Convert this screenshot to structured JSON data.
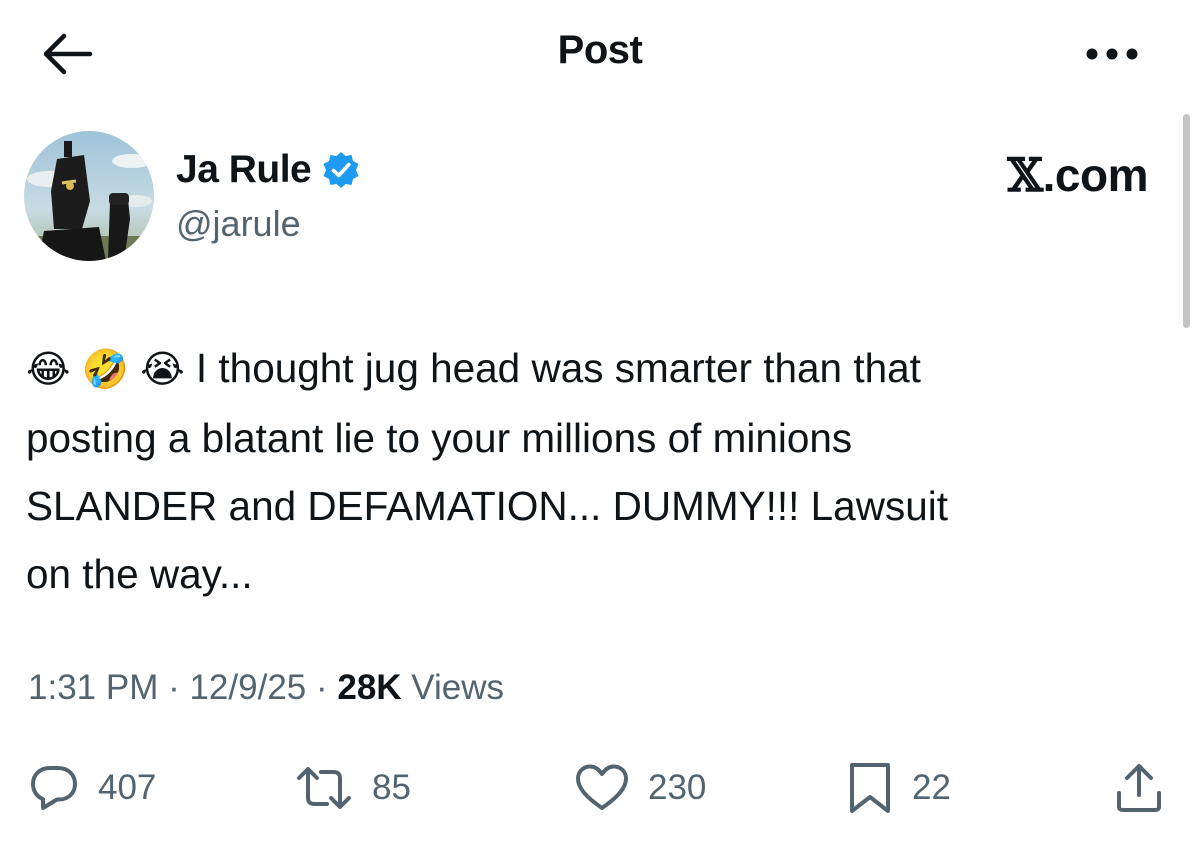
{
  "header": {
    "title": "Post",
    "back_icon": "arrow-left-icon",
    "more_icon": "more-horizontal-icon"
  },
  "author": {
    "name": "Ja Rule",
    "handle": "@jarule",
    "verified": true,
    "verified_color": "#1d9bf0"
  },
  "watermark": {
    "x_glyph": "𝕏",
    "suffix": ".com"
  },
  "post": {
    "emojis": [
      "😂",
      "🤣",
      "😭"
    ],
    "lines": [
      " I thought jug head was smarter than that",
      "posting a blatant lie to your millions of minions",
      "SLANDER and DEFAMATION... DUMMY!!! Lawsuit",
      "on the way..."
    ]
  },
  "meta": {
    "time": "1:31 PM",
    "sep1": " · ",
    "date": "12/9/25",
    "sep2": " · ",
    "views_count": "28K",
    "views_label": " Views"
  },
  "actions": {
    "replies": {
      "icon": "reply-icon",
      "count": "407"
    },
    "reposts": {
      "icon": "repost-icon",
      "count": "85"
    },
    "likes": {
      "icon": "heart-icon",
      "count": "230"
    },
    "bookmarks": {
      "icon": "bookmark-icon",
      "count": "22"
    },
    "share": {
      "icon": "share-icon"
    }
  },
  "colors": {
    "text": "#0f1419",
    "secondary": "#536471",
    "background": "#ffffff"
  }
}
